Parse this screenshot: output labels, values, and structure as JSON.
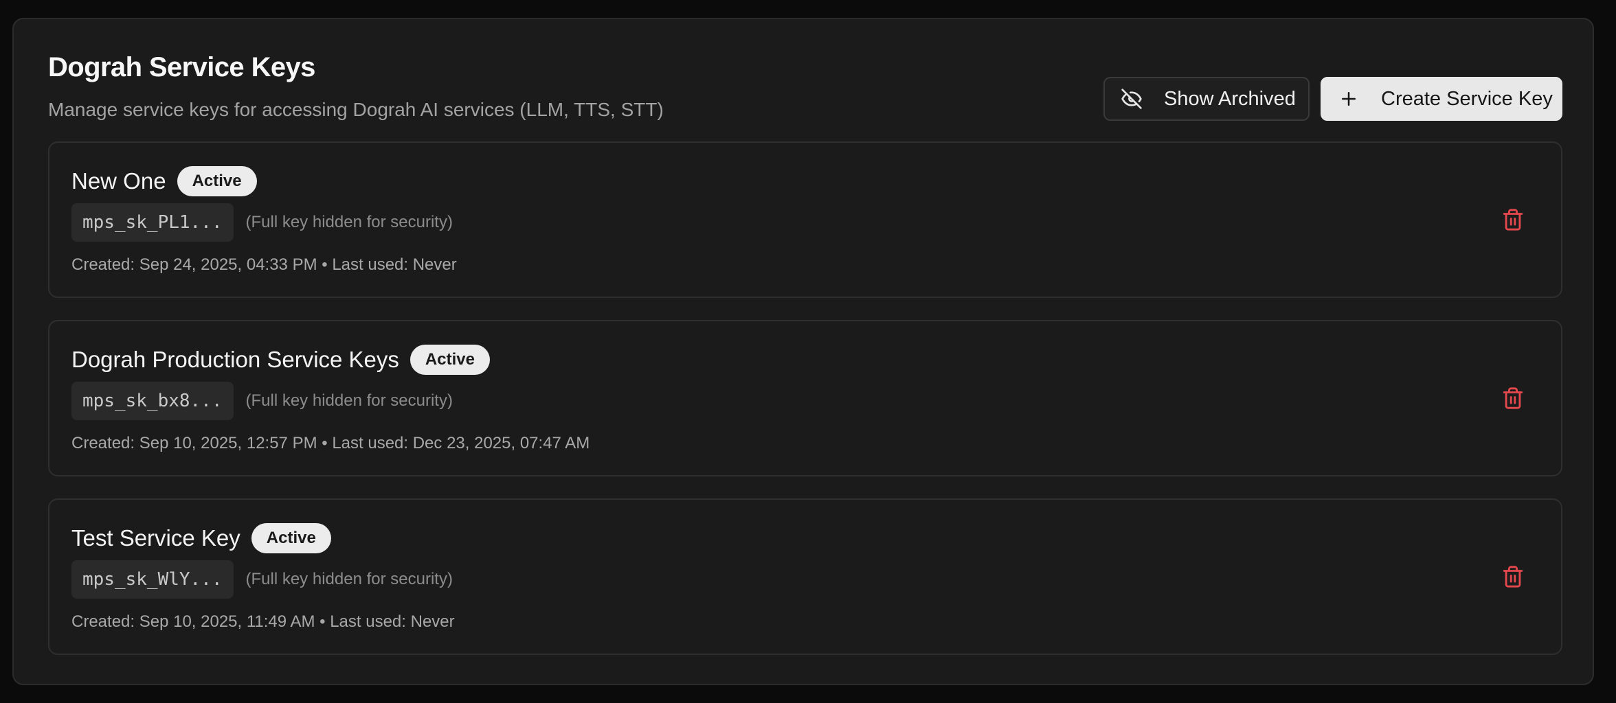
{
  "header": {
    "title": "Dograh Service Keys",
    "subtitle": "Manage service keys for accessing Dograh AI services (LLM, TTS, STT)",
    "show_archived_label": "Show Archived",
    "create_label": "Create Service Key"
  },
  "keys": [
    {
      "name": "New One",
      "status": "Active",
      "key_prefix": "mps_sk_PL1...",
      "hint": "(Full key hidden for security)",
      "meta": "Created: Sep 24, 2025, 04:33 PM • Last used: Never"
    },
    {
      "name": "Dograh Production Service Keys",
      "status": "Active",
      "key_prefix": "mps_sk_bx8...",
      "hint": "(Full key hidden for security)",
      "meta": "Created: Sep 10, 2025, 12:57 PM • Last used: Dec 23, 2025, 07:47 AM"
    },
    {
      "name": "Test Service Key",
      "status": "Active",
      "key_prefix": "mps_sk_WlY...",
      "hint": "(Full key hidden for security)",
      "meta": "Created: Sep 10, 2025, 11:49 AM • Last used: Never"
    }
  ],
  "icons": {
    "show_archived": "eye-off-icon",
    "create": "plus-icon",
    "delete": "trash-icon"
  },
  "colors": {
    "background": "#0b0b0b",
    "panel": "#1b1b1b",
    "delete_icon": "#e5484d",
    "badge_bg": "#ececec",
    "primary_button": "#e8e8e8"
  }
}
